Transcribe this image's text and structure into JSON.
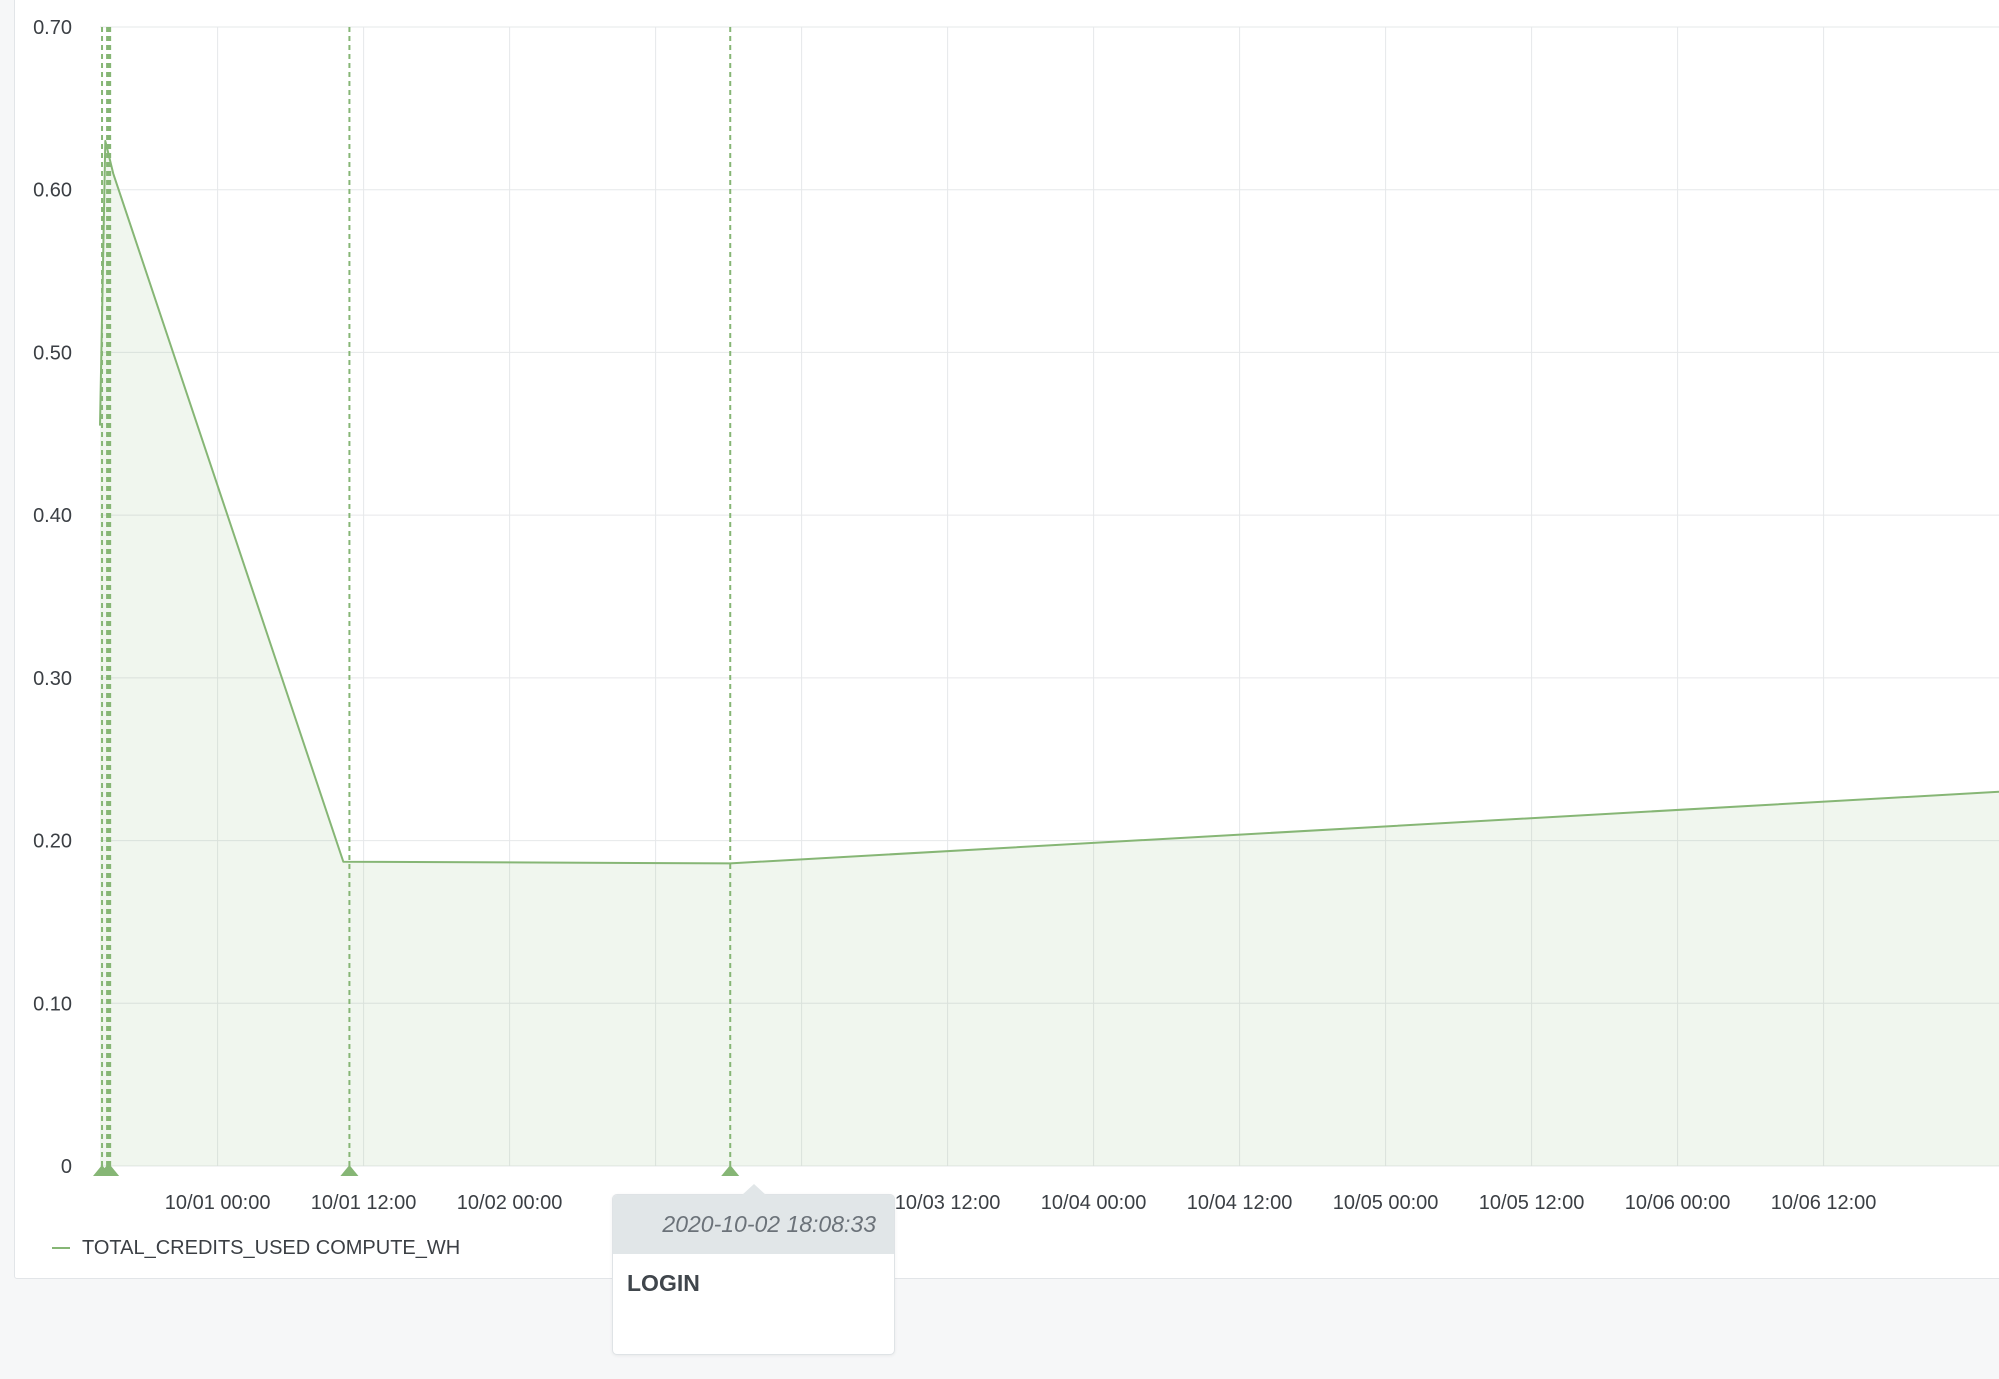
{
  "chart_data": {
    "type": "area",
    "title": "",
    "xlabel": "",
    "ylabel": "",
    "ylim": [
      0,
      0.7
    ],
    "xlim": [
      "2020-09-30 14:20",
      "2020-10-07 02:25"
    ],
    "grid": true,
    "y_ticks": [
      0,
      0.1,
      0.2,
      0.3,
      0.4,
      0.5,
      0.6,
      0.7
    ],
    "y_tick_labels": [
      "0",
      "0.10",
      "0.20",
      "0.30",
      "0.40",
      "0.50",
      "0.60",
      "0.70"
    ],
    "x_ticks": [
      "2020-10-01 00:00",
      "2020-10-01 12:00",
      "2020-10-02 00:00",
      "2020-10-02 12:00",
      "2020-10-03 00:00",
      "2020-10-03 12:00",
      "2020-10-04 00:00",
      "2020-10-04 12:00",
      "2020-10-05 00:00",
      "2020-10-05 12:00",
      "2020-10-06 00:00",
      "2020-10-06 12:00"
    ],
    "x_tick_labels": [
      "10/01 00:00",
      "10/01 12:00",
      "10/02 00:00",
      "",
      "",
      "10/03 12:00",
      "10/04 00:00",
      "10/04 12:00",
      "10/05 00:00",
      "10/05 12:00",
      "10/06 00:00",
      "10/06 12:00"
    ],
    "legend_position": "bottom-left",
    "series": [
      {
        "name": "TOTAL_CREDITS_USED COMPUTE_WH",
        "color": "#86b675",
        "points": [
          [
            "2020-09-30 14:20",
            0.455
          ],
          [
            "2020-09-30 14:46",
            0.63
          ],
          [
            "2020-09-30 15:25",
            0.61
          ],
          [
            "2020-10-01 10:20",
            0.187
          ],
          [
            "2020-10-02 18:08",
            0.186
          ],
          [
            "2020-10-07 02:25",
            0.23
          ]
        ]
      }
    ],
    "event_markers": [
      "2020-09-30 14:30",
      "2020-09-30 14:55",
      "2020-09-30 15:00",
      "2020-09-30 15:05",
      "2020-09-30 15:10",
      "2020-10-01 10:50",
      "2020-10-02 18:08"
    ],
    "tooltip": {
      "time": "2020-10-02 18:08:33",
      "event": "LOGIN"
    }
  }
}
